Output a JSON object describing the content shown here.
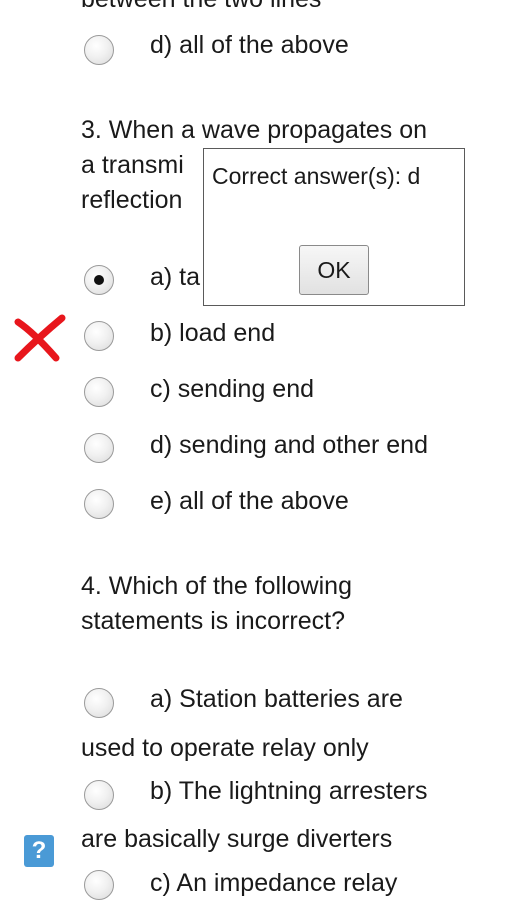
{
  "top_partial_text": "between the two lines",
  "q2": {
    "option_d": {
      "label": "d) all of the above",
      "selected": false
    }
  },
  "q3": {
    "line1": "3. When a wave propagates on",
    "line2": "a transmi",
    "line3": "reflection",
    "options": [
      {
        "label": "a) ta",
        "selected": true
      },
      {
        "label": "b) load end",
        "selected": false
      },
      {
        "label": "c) sending end",
        "selected": false
      },
      {
        "label": "d) sending and other end",
        "selected": false
      },
      {
        "label": "e) all of the above",
        "selected": false
      }
    ]
  },
  "q4": {
    "line1": "4. Which of the following",
    "line2": "statements is incorrect?",
    "options": [
      {
        "label": "a) Station batteries are",
        "continuation": "used to operate relay only"
      },
      {
        "label": "b) The lightning arresters",
        "continuation": "are basically surge diverters"
      },
      {
        "label": "c) An impedance relay"
      }
    ]
  },
  "dialog": {
    "message": "Correct answer(s): d",
    "ok_label": "OK"
  },
  "help": {
    "label": "?",
    "color": "#4a9ad6"
  },
  "marks": {
    "wrong_mark_color": "#e8161c"
  }
}
